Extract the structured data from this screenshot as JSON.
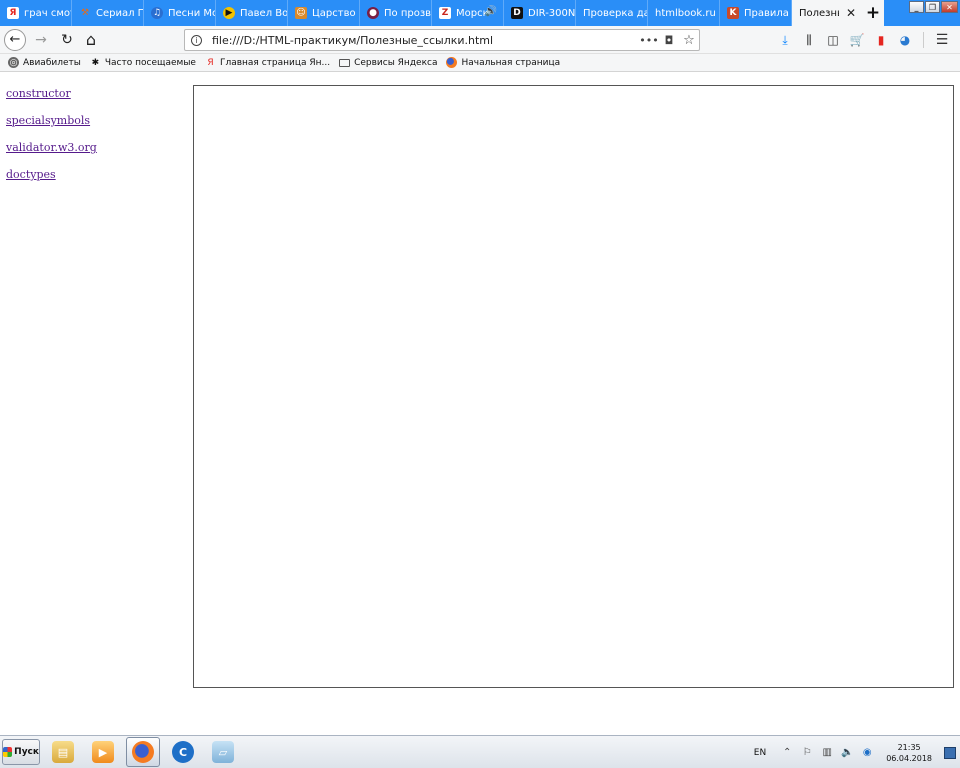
{
  "tabs": [
    {
      "label": "грач смотр",
      "icon": "yandex-icon",
      "color": "#e52620"
    },
    {
      "label": "Сериал Г",
      "icon": "hammer-icon",
      "color": "#e46b1a"
    },
    {
      "label": "Песни Мо",
      "icon": "music-icon",
      "color": "#2a6fd1"
    },
    {
      "label": "Павел Во",
      "icon": "play-icon",
      "color": "#f2c200"
    },
    {
      "label": "Царство",
      "icon": "tiger-icon",
      "color": "#d98a2b"
    },
    {
      "label": "По прозв",
      "icon": "dot-icon",
      "color": "#7a1f44"
    },
    {
      "label": "Морск",
      "icon": "z-logo-icon",
      "color": "#c8261c"
    },
    {
      "label": "DIR-300N",
      "icon": "d-logo-icon",
      "color": "#111111"
    },
    {
      "label": "Проверка дан",
      "icon": "",
      "color": ""
    },
    {
      "label": "htmlbook.ru |",
      "icon": "",
      "color": ""
    },
    {
      "label": "Правила",
      "icon": "k-logo-icon",
      "color": "#c84a2a"
    }
  ],
  "active_tab": {
    "label": "Полезные",
    "close": "✕"
  },
  "new_tab_label": "+",
  "nav": {
    "back": "←",
    "forward": "→",
    "reload": "↻",
    "home": "⌂",
    "url": "file:///D:/HTML-практикум/Полезные_ссылки.html",
    "page_actions": "•••",
    "pocket": "◘",
    "star": "☆"
  },
  "bookmarks": [
    {
      "label": "Авиабилеты",
      "icon": "globe-icon"
    },
    {
      "label": "Часто посещаемые",
      "icon": "gear-icon"
    },
    {
      "label": "Главная страница Ян...",
      "icon": "yandex-icon"
    },
    {
      "label": "Сервисы Яндекса",
      "icon": "folder-icon"
    },
    {
      "label": "Начальная страница",
      "icon": "firefox-icon"
    }
  ],
  "links": [
    "constructor",
    "specialsymbols",
    "validator.w3.org",
    "doctypes"
  ],
  "taskbar": {
    "start_label": "Пуск",
    "lang": "EN",
    "time": "21:35",
    "date": "06.04.2018"
  },
  "colors": {
    "tabstrip": "#2a8ef7",
    "link_visited": "#551a8b",
    "iframe_border": "#555555"
  }
}
